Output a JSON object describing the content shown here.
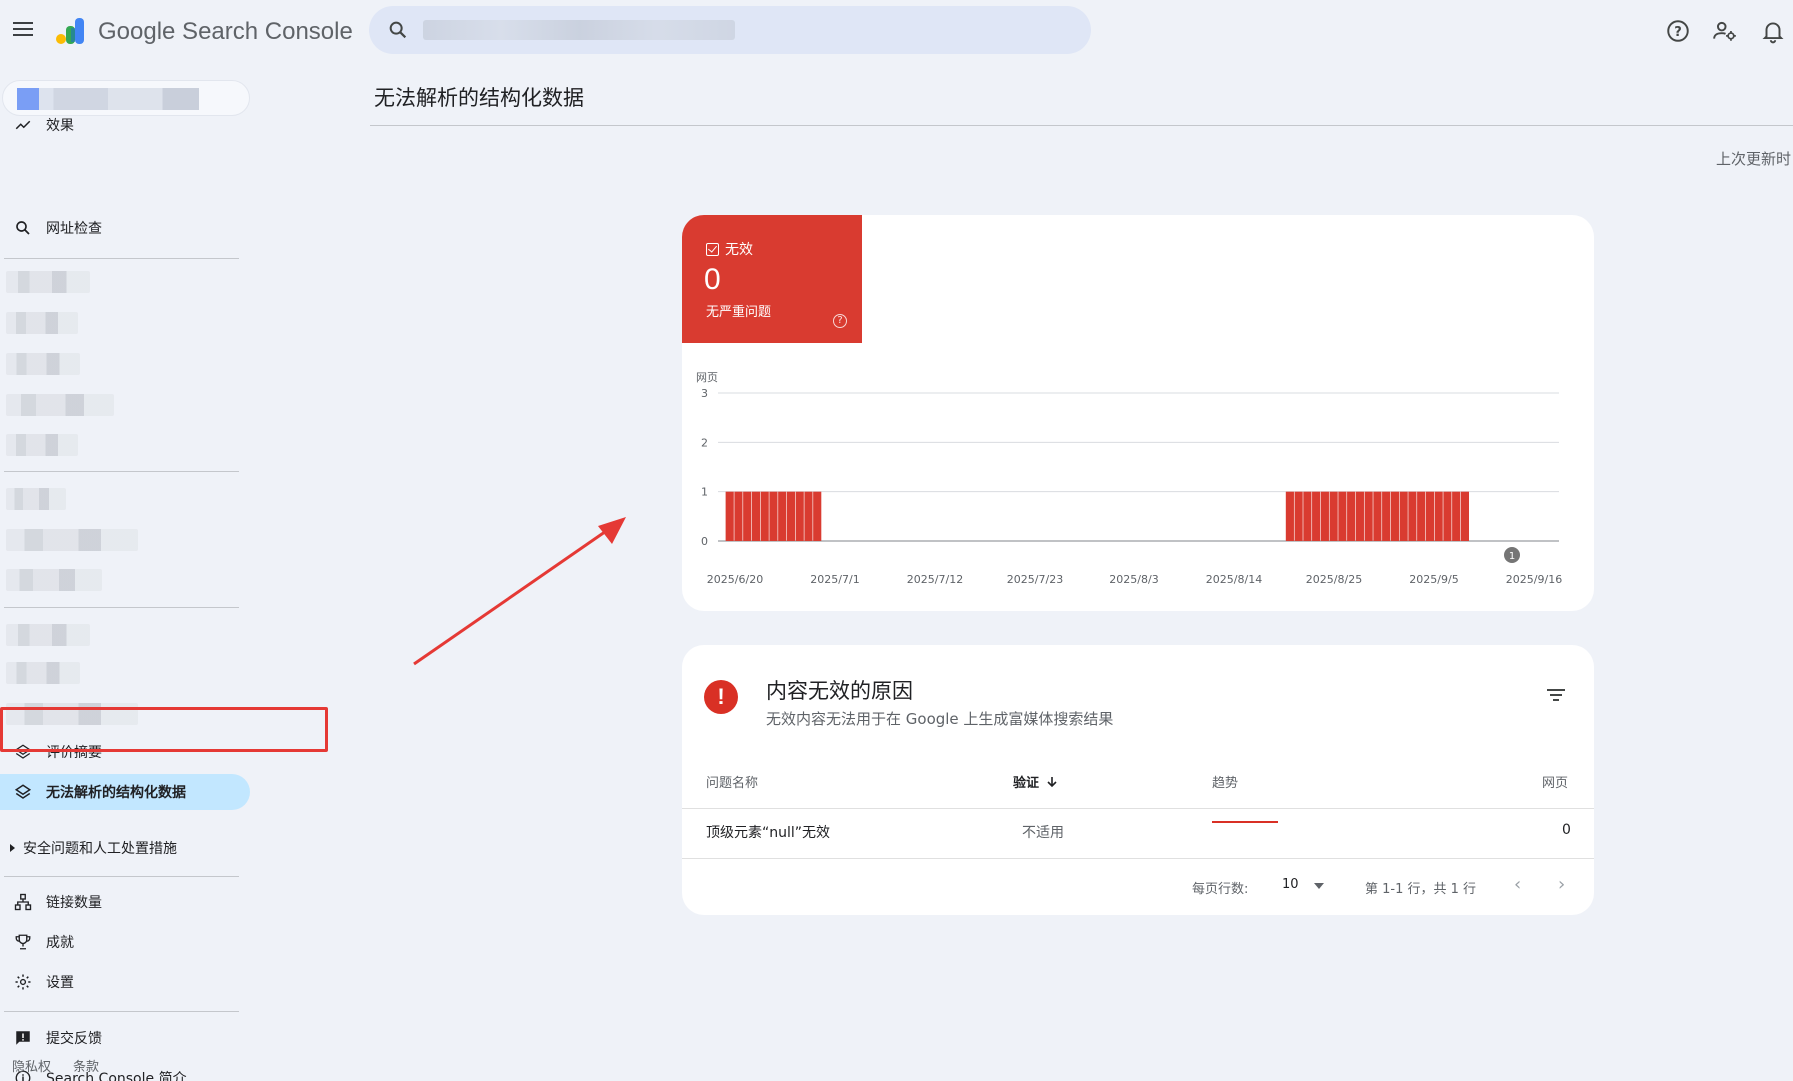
{
  "header": {
    "brand": "Google Search Console",
    "search_placeholder": ""
  },
  "sidebar": {
    "items_top": [
      {
        "label": "效果",
        "icon": "trending-icon"
      },
      {
        "label": "网址检查",
        "icon": "search-icon"
      }
    ],
    "items_mid": [
      {
        "label": "评价摘要",
        "icon": "layers-icon"
      },
      {
        "label": "无法解析的结构化数据",
        "icon": "layers-icon",
        "active": true
      }
    ],
    "security": "安全问题和人工处置措施",
    "items_bottom": [
      {
        "label": "链接数量",
        "icon": "sitemap-icon"
      },
      {
        "label": "成就",
        "icon": "trophy-icon"
      },
      {
        "label": "设置",
        "icon": "gear-icon"
      }
    ],
    "items_footer": [
      {
        "label": "提交反馈",
        "icon": "feedback-icon"
      },
      {
        "label": "Search Console 简介",
        "icon": "info-icon"
      }
    ],
    "footer": {
      "privacy": "隐私权",
      "terms": "条款"
    }
  },
  "main": {
    "title": "无法解析的结构化数据",
    "last_updated": "上次更新时"
  },
  "summary": {
    "label": "无效",
    "count": "0",
    "sub": "无严重问题",
    "help": "?"
  },
  "chart_data": {
    "type": "bar",
    "ylabel": "网页",
    "ylim": [
      0,
      3
    ],
    "yticks": [
      "0",
      "1",
      "2",
      "3"
    ],
    "xticks": [
      "2025/6/20",
      "2025/7/1",
      "2025/7/12",
      "2025/7/23",
      "2025/8/3",
      "2025/8/14",
      "2025/8/25",
      "2025/9/5",
      "2025/9/16"
    ],
    "series": [
      {
        "values": [
          1,
          1,
          1,
          1,
          1,
          1,
          1,
          1,
          1,
          1,
          1,
          0,
          0,
          0,
          0,
          0,
          0,
          0,
          0,
          0,
          0,
          0,
          0,
          0,
          0,
          0,
          0,
          0,
          0,
          0,
          0,
          0,
          0,
          0,
          0,
          0,
          0,
          0,
          0,
          0,
          0,
          0,
          0,
          0,
          0,
          0,
          0,
          0,
          0,
          0,
          0,
          0,
          0,
          0,
          0,
          0,
          0,
          0,
          0,
          0,
          0,
          0,
          0,
          0,
          1,
          1,
          1,
          1,
          1,
          1,
          1,
          1,
          1,
          1,
          1,
          1,
          1,
          1,
          1,
          1,
          1,
          1,
          1,
          1,
          1,
          0,
          0,
          0,
          0,
          0
        ]
      }
    ],
    "annotation": "1",
    "colors": {
      "bar": "#d93b30",
      "grid": "#dadce0"
    }
  },
  "reasons": {
    "title": "内容无效的原因",
    "subtitle": "无效内容无法用于在 Google 上生成富媒体搜索结果",
    "columns": {
      "name": "问题名称",
      "validation": "验证",
      "trend": "趋势",
      "pages": "网页"
    },
    "rows": [
      {
        "name": "顶级元素“null”无效",
        "validation": "不适用",
        "pages": "0"
      }
    ],
    "pager": {
      "rows_label": "每页行数:",
      "rows_value": "10",
      "range": "第 1-1 行，共 1 行"
    }
  }
}
